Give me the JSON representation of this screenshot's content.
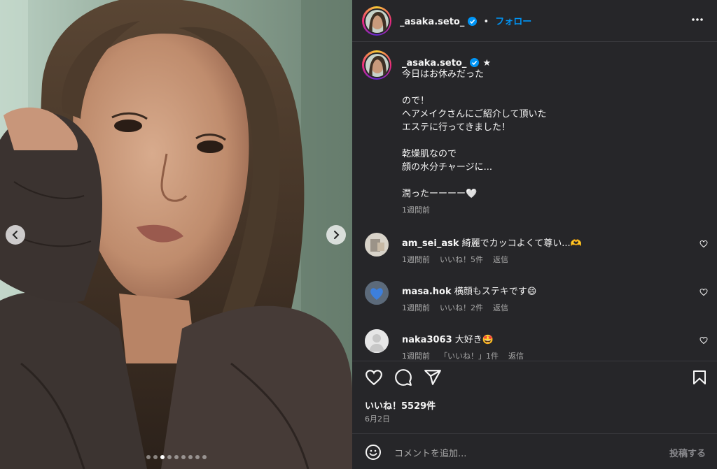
{
  "post": {
    "username": "_asaka.seto_",
    "separator": "•",
    "follow_label": "フォロー",
    "caption_badge": "★",
    "caption": "今日はお休みだった\n\nので！\nヘアメイクさんにご紹介して頂いた\nエステに行ってきました！\n\n乾燥肌なので\n顔の水分チャージに...\n\n潤ったーーーー🤍",
    "caption_time": "1週間前",
    "likes": "いいね！5529件",
    "date": "6月2日",
    "comment_placeholder": "コメントを追加...",
    "post_label": "投稿する"
  },
  "comments": [
    {
      "user": "am_sei_ask",
      "text": "綺麗でカッコよくて尊い...🫶",
      "time": "1週間前",
      "likes": "いいね！5件",
      "reply": "返信"
    },
    {
      "user": "masa.hok",
      "text": "横顔もステキです😄",
      "time": "1週間前",
      "likes": "いいね！2件",
      "reply": "返信"
    },
    {
      "user": "naka3063",
      "text": "大好き🤩",
      "time": "1週間前",
      "likes": "「いいね！」1件",
      "reply": "返信"
    }
  ],
  "carousel": {
    "slides": 9,
    "active_index": 2
  },
  "icons": {
    "more": "more-horizontal-icon",
    "verified": "verified-badge-icon",
    "like": "heart-icon",
    "comment": "comment-bubble-icon",
    "share": "paper-plane-icon",
    "save": "bookmark-icon",
    "emoji": "smiley-icon",
    "prev": "chevron-left-icon",
    "next": "chevron-right-icon"
  },
  "colors": {
    "accent": "#0095f6",
    "panel": "#262629",
    "muted": "#a8a8a8"
  }
}
